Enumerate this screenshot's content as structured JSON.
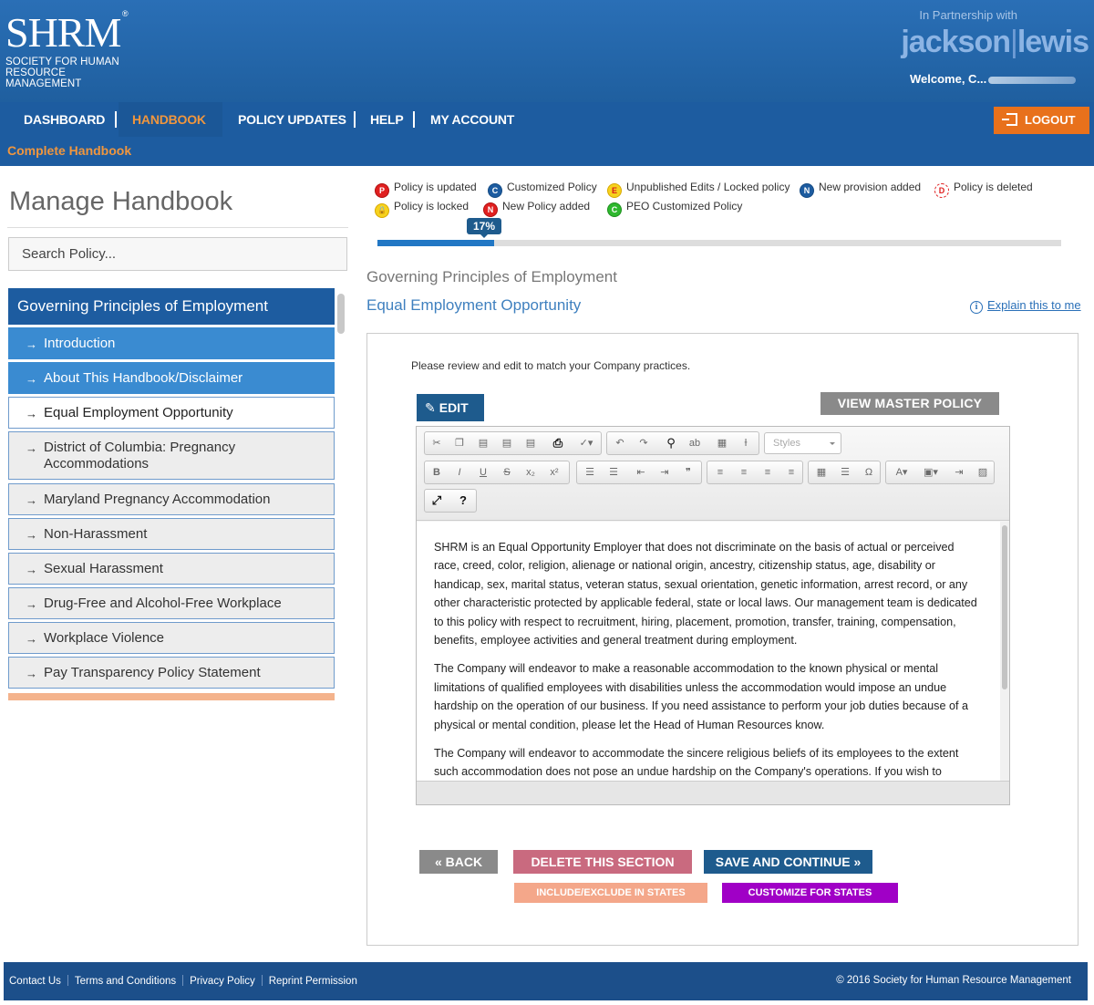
{
  "header": {
    "logo_mark": "SHRM",
    "logo_reg": "®",
    "logo_line1": "SOCIETY FOR HUMAN",
    "logo_line2": "RESOURCE MANAGEMENT",
    "partner_label": "In Partnership with",
    "partner_brand_a": "jackson",
    "partner_brand_sep": "|",
    "partner_brand_b": "lewis",
    "welcome": "Welcome, C..."
  },
  "nav": {
    "items": [
      {
        "label": "DASHBOARD"
      },
      {
        "label": "HANDBOOK"
      },
      {
        "label": "POLICY UPDATES"
      },
      {
        "label": "HELP"
      },
      {
        "label": "MY ACCOUNT"
      }
    ],
    "logout_label": "LOGOUT",
    "subnav_label": "Complete Handbook"
  },
  "sidebar": {
    "title": "Manage Handbook",
    "search_placeholder": "Search Policy...",
    "section_header": "Governing Principles of Employment",
    "items": [
      {
        "label": "Introduction"
      },
      {
        "label": "About This Handbook/Disclaimer"
      },
      {
        "label": "Equal Employment Opportunity"
      },
      {
        "label": "District of Columbia: Pregnancy Accommodations"
      },
      {
        "label": "Maryland Pregnancy Accommodation"
      },
      {
        "label": "Non-Harassment"
      },
      {
        "label": "Sexual Harassment"
      },
      {
        "label": "Drug-Free and Alcohol-Free Workplace"
      },
      {
        "label": "Workplace Violence"
      },
      {
        "label": "Pay Transparency Policy Statement"
      }
    ]
  },
  "legend": [
    {
      "badge": "P",
      "label": "Policy is updated"
    },
    {
      "badge": "C",
      "label": "Customized Policy"
    },
    {
      "badge": "E",
      "label": "Unpublished Edits / Locked policy"
    },
    {
      "badge": "N",
      "label": "New provision added"
    },
    {
      "badge": "D",
      "label": "Policy is deleted"
    },
    {
      "badge": "🔒",
      "label": "Policy is locked"
    },
    {
      "badge": "N",
      "label": "New Policy added"
    },
    {
      "badge": "C",
      "label": "PEO Customized Policy"
    }
  ],
  "progress": {
    "label": "17%",
    "value": 17
  },
  "content": {
    "section_title": "Governing Principles of Employment",
    "policy_title": "Equal Employment Opportunity",
    "explain_link": "Explain this to me",
    "instructions": "Please review and edit to match your Company practices.",
    "edit_label": "EDIT",
    "view_master_label": "VIEW MASTER POLICY",
    "styles_label": "Styles",
    "paragraphs": [
      "SHRM is an Equal Opportunity Employer that does not discriminate on the basis of actual or perceived race, creed, color, religion, alienage or national origin, ancestry, citizenship status, age, disability or handicap, sex, marital status, veteran status, sexual orientation, genetic information, arrest record, or any other characteristic protected by applicable federal, state or local laws. Our management team is dedicated to this policy with respect to recruitment, hiring, placement, promotion, transfer, training, compensation, benefits, employee activities and general treatment during employment.",
      "The Company will endeavor to make a reasonable accommodation to the known physical or mental limitations of qualified employees with disabilities unless the accommodation would impose an undue hardship on the operation of our business. If you need assistance to perform your job duties because of a physical or mental condition, please let the Head of Human Resources know.",
      "The Company will endeavor to accommodate the sincere religious beliefs of its employees to the extent such accommodation does not pose an undue hardship on the Company's operations. If you wish to"
    ]
  },
  "actions": {
    "back": "« BACK",
    "delete": "DELETE THIS SECTION",
    "save": "SAVE AND CONTINUE »",
    "include": "INCLUDE/EXCLUDE IN STATES",
    "customize": "CUSTOMIZE FOR STATES"
  },
  "footer": {
    "links": [
      "Contact Us",
      "Terms and Conditions",
      "Privacy Policy",
      "Reprint Permission"
    ],
    "copyright": "© 2016 Society for Human Resource Management"
  },
  "colors": {
    "brand_blue": "#1d5ca0",
    "accent_orange": "#e8711c",
    "delete_pink": "#c96a7f",
    "customize_purple": "#a000c6"
  }
}
